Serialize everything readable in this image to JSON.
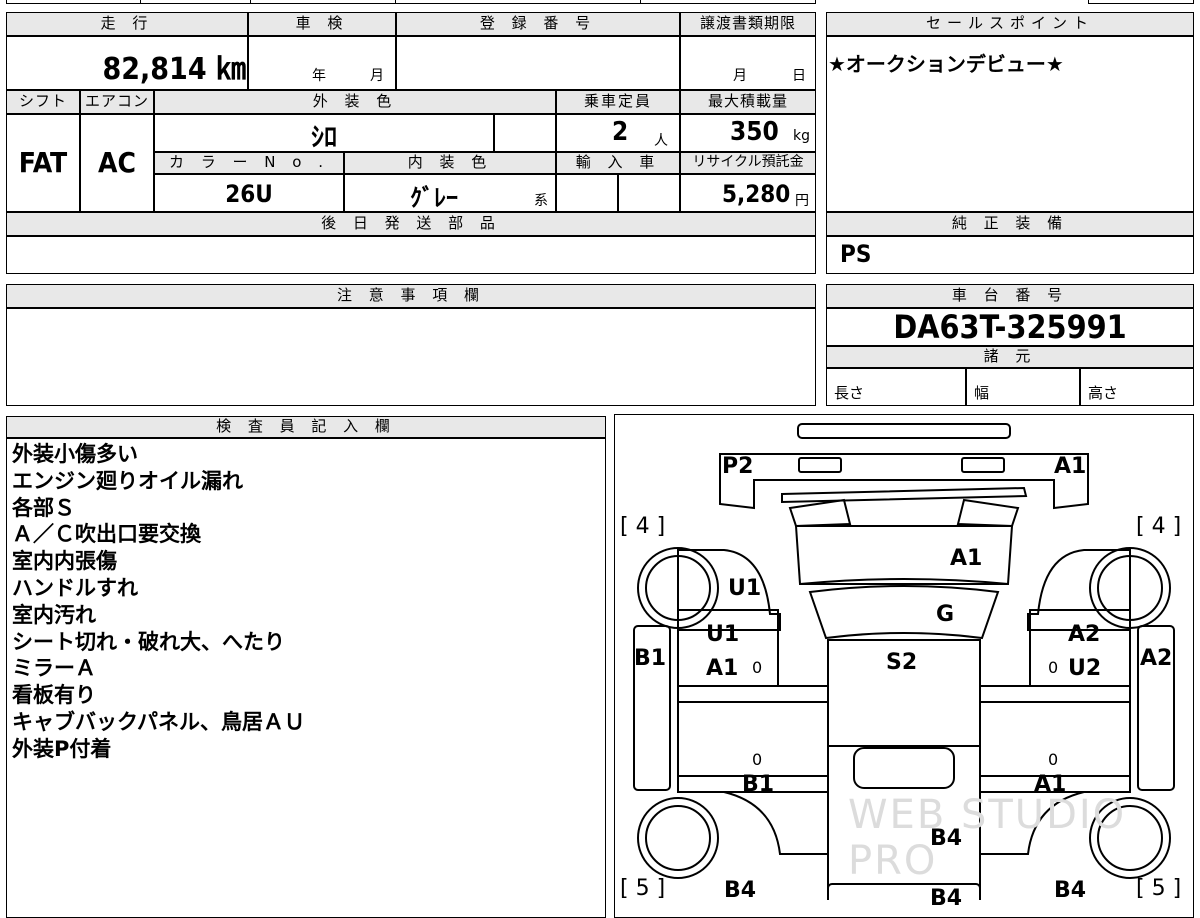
{
  "labels": {
    "mileage": "走 行",
    "inspection": "車 検",
    "registration": "登 録 番 号",
    "transfer_deadline": "譲渡書類期限",
    "sales_point": "セールスポイント",
    "shift": "シフト",
    "aircon": "エアコン",
    "exterior_color": "外 装 色",
    "capacity": "乗車定員",
    "max_load": "最大積載量",
    "color_no": "カ ラ ー N o .",
    "interior_color": "内 装 色",
    "import": "輸 入 車",
    "recycle_fee": "リサイクル預託金",
    "later_parts": "後 日 発 送 部 品",
    "genuine_equipment": "純 正 装 備",
    "notes_column": "注 意 事 項 欄",
    "chassis_number": "車 台 番 号",
    "specs": "諸 元",
    "length": "長さ",
    "width": "幅",
    "height": "高さ",
    "inspector_column": "検 査 員 記 入 欄"
  },
  "values": {
    "mileage": "82,814 ㎞",
    "inspection_year": "年",
    "inspection_month": "月",
    "transfer_month": "月",
    "transfer_day": "日",
    "sales_point": "★オークションデビュー★",
    "shift": "FAT",
    "aircon": "AC",
    "exterior_color": "ｼﾛ",
    "capacity": "2",
    "capacity_unit": "人",
    "max_load": "350",
    "max_load_unit": "kg",
    "color_no": "26U",
    "interior_color": "ｸﾞﾚｰ",
    "interior_suffix": "系",
    "recycle_fee": "5,280",
    "recycle_unit": "円",
    "genuine_equipment": "PS",
    "chassis_number": "DA63T-325991"
  },
  "inspector_notes": [
    "外装小傷多い",
    "エンジン廻りオイル漏れ",
    "各部Ｓ",
    "Ａ／Ｃ吹出口要交換",
    "室内内張傷",
    "ハンドルすれ",
    "室内汚れ",
    "シート切れ・破れ大、へたり",
    "ミラーＡ",
    "看板有り",
    "キャブバックパネル、鳥居ＡＵ",
    "外装P付着"
  ],
  "diagram": {
    "p2": "P2",
    "a1_top": "A1",
    "bracket_4_left": "[ 4 ]",
    "bracket_4_right": "[ 4 ]",
    "a1_hood": "A1",
    "u1_left_fender": "U1",
    "g_windshield": "G",
    "u1_left_door": "U1",
    "a1_left_door": "A1",
    "b1_left_mirror": "B1",
    "s2_roof": "S2",
    "a2_right_door": "A2",
    "u2_right_door": "U2",
    "a2_right_mirror": "A2",
    "b1_left_bed": "B1",
    "a1_right_bed": "A1",
    "b4_center": "B4",
    "b4_bottom_left": "B4",
    "b4_bottom_center": "B4",
    "b4_bottom_right": "B4",
    "bracket_5_left": "[ 5 ]",
    "bracket_5_right": "[ 5 ]",
    "zero": "0",
    "watermark": "WEB STUDIO PRO"
  }
}
